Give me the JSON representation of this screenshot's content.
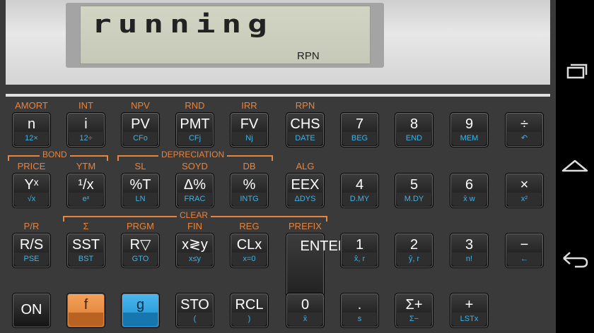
{
  "display": {
    "text": "running",
    "mode": "RPN"
  },
  "brackets": {
    "bond": "BOND",
    "depreciation": "DEPRECIATION",
    "clear": "CLEAR"
  },
  "keys": [
    {
      "id": "n",
      "gold": "AMORT",
      "main": "n",
      "sub": "12×"
    },
    {
      "id": "i",
      "gold": "INT",
      "main": "i",
      "sub": "12÷"
    },
    {
      "id": "pv",
      "gold": "NPV",
      "main": "PV",
      "sub": "CFo"
    },
    {
      "id": "pmt",
      "gold": "RND",
      "main": "PMT",
      "sub": "CFj"
    },
    {
      "id": "fv",
      "gold": "IRR",
      "main": "FV",
      "sub": "Nj"
    },
    {
      "id": "chs",
      "gold": "RPN",
      "main": "CHS",
      "sub": "DATE"
    },
    {
      "id": "7",
      "gold": "",
      "main": "7",
      "sub": "BEG"
    },
    {
      "id": "8",
      "gold": "",
      "main": "8",
      "sub": "END"
    },
    {
      "id": "9",
      "gold": "",
      "main": "9",
      "sub": "MEM"
    },
    {
      "id": "div",
      "gold": "",
      "main": "÷",
      "sub": "↶"
    },
    {
      "id": "yx",
      "gold": "PRICE",
      "main": "Yˣ",
      "sub": "√x"
    },
    {
      "id": "inv",
      "gold": "YTM",
      "main": "¹/x",
      "sub": "eˣ"
    },
    {
      "id": "pct-t",
      "gold": "SL",
      "main": "%T",
      "sub": "LN"
    },
    {
      "id": "delta-pct",
      "gold": "SOYD",
      "main": "Δ%",
      "sub": "FRAC"
    },
    {
      "id": "pct",
      "gold": "DB",
      "main": "%",
      "sub": "INTG"
    },
    {
      "id": "eex",
      "gold": "ALG",
      "main": "EEX",
      "sub": "ΔDYS"
    },
    {
      "id": "4",
      "gold": "",
      "main": "4",
      "sub": "D.MY"
    },
    {
      "id": "5",
      "gold": "",
      "main": "5",
      "sub": "M.DY"
    },
    {
      "id": "6",
      "gold": "",
      "main": "6",
      "sub": "x̄ w"
    },
    {
      "id": "mul",
      "gold": "",
      "main": "×",
      "sub": "x²"
    },
    {
      "id": "rs",
      "gold": "P/R",
      "main": "R/S",
      "sub": "PSE"
    },
    {
      "id": "sst",
      "gold": "Σ",
      "main": "SST",
      "sub": "BST"
    },
    {
      "id": "rdown",
      "gold": "PRGM",
      "main": "R▽",
      "sub": "GTO"
    },
    {
      "id": "xy",
      "gold": "FIN",
      "main": "x≷y",
      "sub": "x≤y"
    },
    {
      "id": "clx",
      "gold": "REG",
      "main": "CLx",
      "sub": "x=0"
    },
    {
      "id": "enter",
      "gold": "PREFIX",
      "main": "ENTER",
      "sub": "="
    },
    {
      "id": "1",
      "gold": "",
      "main": "1",
      "sub": "x̂, r"
    },
    {
      "id": "2",
      "gold": "",
      "main": "2",
      "sub": "ŷ, r"
    },
    {
      "id": "3",
      "gold": "",
      "main": "3",
      "sub": "n!"
    },
    {
      "id": "minus",
      "gold": "",
      "main": "−",
      "sub": "←"
    },
    {
      "id": "on",
      "gold": "",
      "main": "ON",
      "sub": ""
    },
    {
      "id": "f",
      "gold": "",
      "main": "f",
      "sub": ""
    },
    {
      "id": "g",
      "gold": "",
      "main": "g",
      "sub": ""
    },
    {
      "id": "sto",
      "gold": "",
      "main": "STO",
      "sub": "("
    },
    {
      "id": "rcl",
      "gold": "",
      "main": "RCL",
      "sub": ")"
    },
    {
      "id": "0",
      "gold": "",
      "main": "0",
      "sub": "x̄"
    },
    {
      "id": "dot",
      "gold": "",
      "main": ".",
      "sub": "s"
    },
    {
      "id": "sigma",
      "gold": "",
      "main": "Σ+",
      "sub": "Σ−"
    },
    {
      "id": "plus",
      "gold": "",
      "main": "+",
      "sub": "LSTx"
    }
  ],
  "colors": {
    "body": "#3a3a3a",
    "gold": "#e8843e",
    "blue": "#3fb3e8",
    "f_key": "#f29a4e",
    "g_key": "#3aaee8"
  },
  "nav": [
    {
      "icon": "recent-apps-icon"
    },
    {
      "icon": "home-icon"
    },
    {
      "icon": "back-icon"
    }
  ]
}
